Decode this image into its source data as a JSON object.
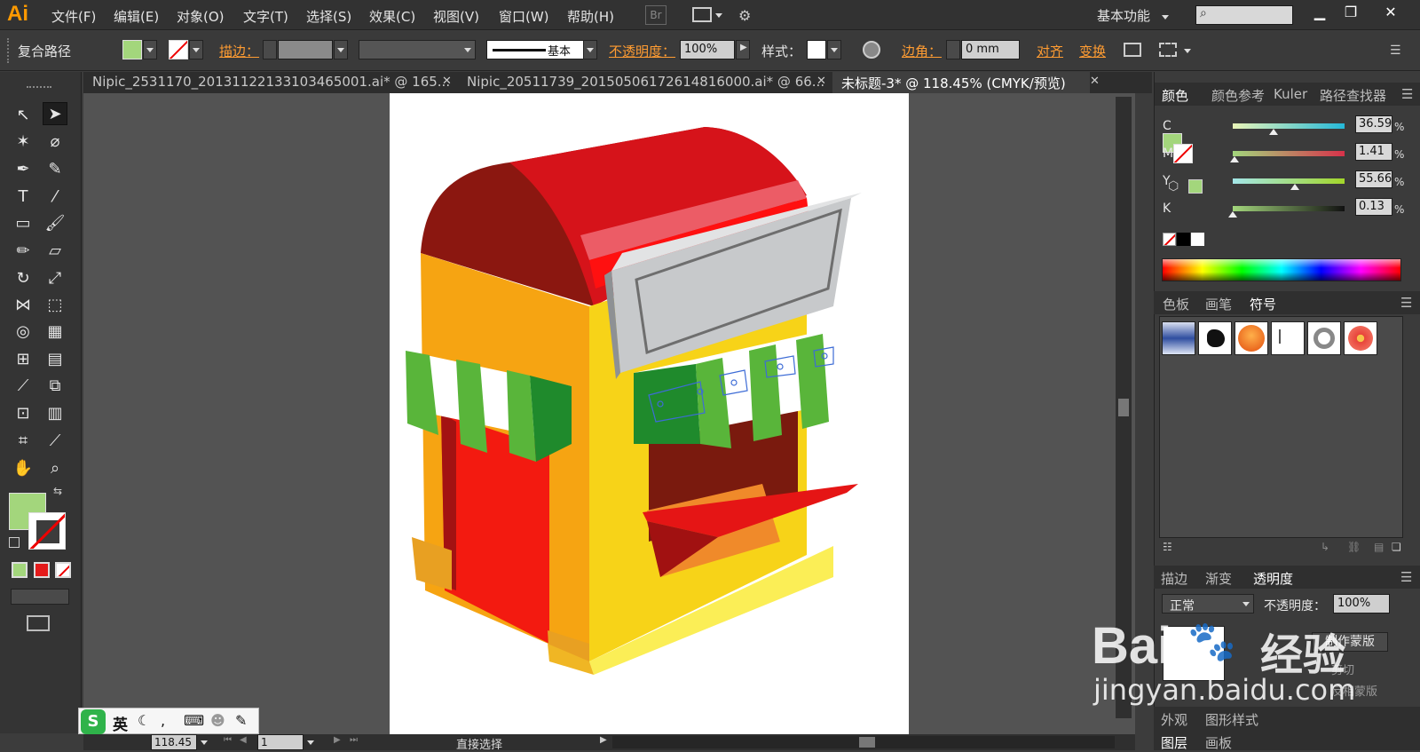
{
  "app": {
    "logo": "Ai",
    "workspace": "基本功能"
  },
  "menu": [
    "文件(F)",
    "编辑(E)",
    "对象(O)",
    "文字(T)",
    "选择(S)",
    "效果(C)",
    "视图(V)",
    "窗口(W)",
    "帮助(H)"
  ],
  "toolbar_bridge": "Br",
  "control": {
    "object_type": "复合路径",
    "stroke_label": "描边：",
    "stroke_style": "基本",
    "opacity_label": "不透明度：",
    "opacity_value": "100%",
    "style_label": "样式：",
    "corner_label": "边角：",
    "corner_value": "0 mm",
    "align": "对齐",
    "transform": "变换"
  },
  "tabs": [
    {
      "label": "Nipic_2531170_20131122133103465001.ai* @ 165...",
      "active": false
    },
    {
      "label": "Nipic_20511739_20150506172614816000.ai* @ 66...",
      "active": false
    },
    {
      "label": "未标题-3* @ 118.45% (CMYK/预览)",
      "active": true
    }
  ],
  "color_panel": {
    "tabs": [
      "颜色",
      "颜色参考",
      "Kuler",
      "路径查找器"
    ],
    "sliders": [
      {
        "label": "C",
        "value": "36.59",
        "percent": 36.59
      },
      {
        "label": "M",
        "value": "1.41",
        "percent": 1.41
      },
      {
        "label": "Y",
        "value": "55.66",
        "percent": 55.66
      },
      {
        "label": "K",
        "value": "0.13",
        "percent": 0.13
      }
    ],
    "percent_sign": "%"
  },
  "swatch_panel": {
    "tabs": [
      "色板",
      "画笔",
      "符号"
    ]
  },
  "transparency_panel": {
    "tabs": [
      "描边",
      "渐变",
      "透明度"
    ],
    "blend_mode": "正常",
    "opacity_label": "不透明度：",
    "opacity_value": "100%",
    "make_mask": "制作蒙版",
    "clip": "剪切",
    "invert": "反相蒙版"
  },
  "appearance_panel": {
    "tabs": [
      "外观",
      "图形样式"
    ]
  },
  "layers_panel": {
    "tabs": [
      "图层",
      "画板"
    ]
  },
  "status": {
    "zoom": "118.45",
    "artboard": "1",
    "tool": "直接选择"
  },
  "ime": {
    "lang": "英"
  },
  "watermark": {
    "brand": "Bai",
    "brand2": "经验",
    "url": "jingyan.baidu.com"
  },
  "colors": {
    "fill": "#a3d67c",
    "accent": "#ff9c32",
    "canvas": "#535353"
  }
}
